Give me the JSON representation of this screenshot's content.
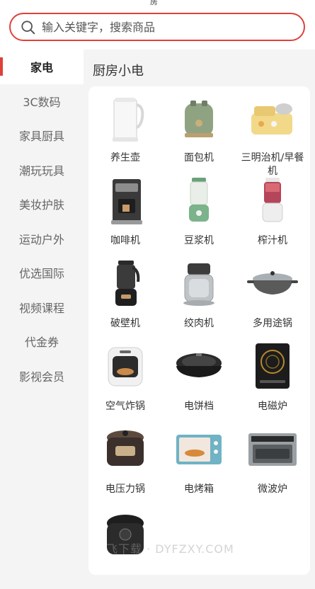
{
  "status_fragment": "房",
  "search": {
    "placeholder": "输入关键字，搜索商品"
  },
  "sidebar": {
    "items": [
      {
        "label": "家电",
        "active": true
      },
      {
        "label": "3C数码",
        "active": false
      },
      {
        "label": "家具厨具",
        "active": false
      },
      {
        "label": "潮玩玩具",
        "active": false
      },
      {
        "label": "美妆护肤",
        "active": false
      },
      {
        "label": "运动户外",
        "active": false
      },
      {
        "label": "优选国际",
        "active": false
      },
      {
        "label": "视频课程",
        "active": false
      },
      {
        "label": "代金券",
        "active": false
      },
      {
        "label": "影视会员",
        "active": false
      }
    ]
  },
  "main": {
    "section_title": "厨房小电",
    "products": [
      {
        "label": "养生壶",
        "icon": "kettle-icon"
      },
      {
        "label": "面包机",
        "icon": "toaster-icon"
      },
      {
        "label": "三明治机/早餐机",
        "icon": "breakfast-machine-icon"
      },
      {
        "label": "咖啡机",
        "icon": "coffee-machine-icon"
      },
      {
        "label": "豆浆机",
        "icon": "soymilk-maker-icon"
      },
      {
        "label": "榨汁机",
        "icon": "juicer-icon"
      },
      {
        "label": "破壁机",
        "icon": "high-speed-blender-icon"
      },
      {
        "label": "绞肉机",
        "icon": "meat-grinder-icon"
      },
      {
        "label": "多用途锅",
        "icon": "multi-pot-icon"
      },
      {
        "label": "空气炸锅",
        "icon": "air-fryer-icon"
      },
      {
        "label": "电饼档",
        "icon": "electric-griddle-icon"
      },
      {
        "label": "电磁炉",
        "icon": "induction-cooker-icon"
      },
      {
        "label": "电压力锅",
        "icon": "pressure-cooker-icon"
      },
      {
        "label": "电烤箱",
        "icon": "electric-oven-icon"
      },
      {
        "label": "微波炉",
        "icon": "microwave-icon"
      },
      {
        "label": "",
        "icon": "rice-cooker-icon"
      }
    ]
  },
  "watermark": "飞下载 · DYFZXY.COM",
  "colors": {
    "accent": "#e0403a",
    "background": "#f4f4f4",
    "card": "#ffffff"
  }
}
